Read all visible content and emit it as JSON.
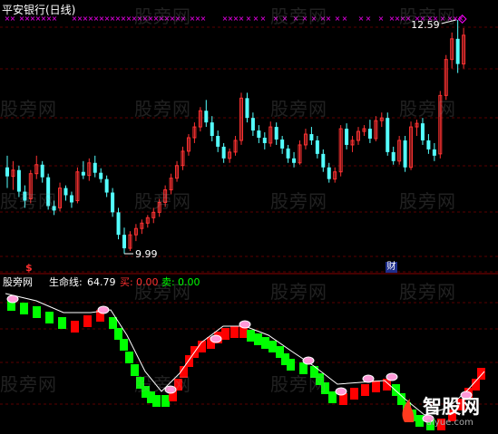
{
  "upper": {
    "title": "平安银行(日线)",
    "high_label": "12.59",
    "low_label": "9.99",
    "event_markers": [
      {
        "text": "$",
        "color": "#ff3030"
      },
      {
        "text": "财",
        "color": "#ffffff"
      }
    ]
  },
  "lower": {
    "name": "股旁网",
    "lifeline_label": "生命线:",
    "lifeline_value": "64.79",
    "buy_label": "买:",
    "buy_value": "0.00",
    "sell_label": "卖:",
    "sell_value": "0.00"
  },
  "watermark": "股旁网",
  "logo": {
    "text": "智股网",
    "url": "aiyue.com"
  },
  "colors": {
    "up": "#ff3232",
    "down": "#54ffff",
    "red": "#ff0000",
    "green": "#00ff00",
    "grid": "#5a0000",
    "magenta": "#ff00ff"
  },
  "chart_data": [
    {
      "type": "candlestick",
      "title": "平安银行(日线)",
      "annotations": [
        "12.59",
        "9.99"
      ],
      "ohlc": [
        [
          10.95,
          11.08,
          10.72,
          10.85
        ],
        [
          10.85,
          11.02,
          10.7,
          10.92
        ],
        [
          10.92,
          10.97,
          10.62,
          10.68
        ],
        [
          10.68,
          10.75,
          10.5,
          10.58
        ],
        [
          10.6,
          10.92,
          10.55,
          10.88
        ],
        [
          10.88,
          11.08,
          10.82,
          10.98
        ],
        [
          10.98,
          11.02,
          10.78,
          10.84
        ],
        [
          10.84,
          10.88,
          10.48,
          10.52
        ],
        [
          10.52,
          10.58,
          10.42,
          10.47
        ],
        [
          10.5,
          10.78,
          10.46,
          10.72
        ],
        [
          10.72,
          10.75,
          10.58,
          10.64
        ],
        [
          10.64,
          10.68,
          10.5,
          10.56
        ],
        [
          10.58,
          10.95,
          10.55,
          10.9
        ],
        [
          10.9,
          11.02,
          10.82,
          10.86
        ],
        [
          10.86,
          11.05,
          10.8,
          11.0
        ],
        [
          11.0,
          11.08,
          10.84,
          10.89
        ],
        [
          10.89,
          10.94,
          10.78,
          10.82
        ],
        [
          10.82,
          10.86,
          10.62,
          10.67
        ],
        [
          10.67,
          10.72,
          10.4,
          10.45
        ],
        [
          10.45,
          10.5,
          10.15,
          10.2
        ],
        [
          10.2,
          10.28,
          9.99,
          10.05
        ],
        [
          10.05,
          10.24,
          10.02,
          10.2
        ],
        [
          10.2,
          10.32,
          10.13,
          10.27
        ],
        [
          10.27,
          10.37,
          10.21,
          10.33
        ],
        [
          10.33,
          10.42,
          10.28,
          10.39
        ],
        [
          10.39,
          10.5,
          10.33,
          10.45
        ],
        [
          10.45,
          10.6,
          10.4,
          10.56
        ],
        [
          10.56,
          10.75,
          10.51,
          10.7
        ],
        [
          10.7,
          10.88,
          10.65,
          10.83
        ],
        [
          10.83,
          11.02,
          10.79,
          10.97
        ],
        [
          10.97,
          11.18,
          10.92,
          11.13
        ],
        [
          11.13,
          11.32,
          11.08,
          11.28
        ],
        [
          11.28,
          11.45,
          11.22,
          11.4
        ],
        [
          11.4,
          11.62,
          11.35,
          11.58
        ],
        [
          11.58,
          11.7,
          11.4,
          11.45
        ],
        [
          11.45,
          11.52,
          11.24,
          11.3
        ],
        [
          11.3,
          11.36,
          11.12,
          11.18
        ],
        [
          11.18,
          11.22,
          11.0,
          11.05
        ],
        [
          11.05,
          11.16,
          11.0,
          11.12
        ],
        [
          11.12,
          11.3,
          11.08,
          11.25
        ],
        [
          11.25,
          11.78,
          11.2,
          11.72
        ],
        [
          11.72,
          11.78,
          11.45,
          11.5
        ],
        [
          11.5,
          11.56,
          11.3,
          11.36
        ],
        [
          11.36,
          11.42,
          11.22,
          11.28
        ],
        [
          11.28,
          11.34,
          11.15,
          11.22
        ],
        [
          11.22,
          11.46,
          11.18,
          11.4
        ],
        [
          11.4,
          11.45,
          11.2,
          11.26
        ],
        [
          11.26,
          11.3,
          11.1,
          11.16
        ],
        [
          11.16,
          11.2,
          11.0,
          11.05
        ],
        [
          11.05,
          11.12,
          10.95,
          11.0
        ],
        [
          11.0,
          11.25,
          10.98,
          11.2
        ],
        [
          11.2,
          11.38,
          11.15,
          11.32
        ],
        [
          11.32,
          11.4,
          11.2,
          11.25
        ],
        [
          11.25,
          11.3,
          11.05,
          11.1
        ],
        [
          11.1,
          11.15,
          10.9,
          10.95
        ],
        [
          10.95,
          11.0,
          10.78,
          10.82
        ],
        [
          10.82,
          10.95,
          10.78,
          10.9
        ],
        [
          10.9,
          11.42,
          10.85,
          11.38
        ],
        [
          11.38,
          11.44,
          11.15,
          11.2
        ],
        [
          11.2,
          11.3,
          11.12,
          11.25
        ],
        [
          11.25,
          11.4,
          11.2,
          11.35
        ],
        [
          11.35,
          11.42,
          11.3,
          11.38
        ],
        [
          11.38,
          11.48,
          11.22,
          11.27
        ],
        [
          11.27,
          11.52,
          11.24,
          11.47
        ],
        [
          11.47,
          11.56,
          11.4,
          11.5
        ],
        [
          11.5,
          11.56,
          11.08,
          11.12
        ],
        [
          11.12,
          11.18,
          10.98,
          11.02
        ],
        [
          11.02,
          11.3,
          10.98,
          11.25
        ],
        [
          11.25,
          11.3,
          10.9,
          10.95
        ],
        [
          10.95,
          11.46,
          10.92,
          11.4
        ],
        [
          11.4,
          11.48,
          11.3,
          11.44
        ],
        [
          11.44,
          11.5,
          11.2,
          11.25
        ],
        [
          11.25,
          11.32,
          11.1,
          11.15
        ],
        [
          11.15,
          11.22,
          11.02,
          11.08
        ],
        [
          11.1,
          11.8,
          11.05,
          11.75
        ],
        [
          11.75,
          12.2,
          11.7,
          12.15
        ],
        [
          12.15,
          12.45,
          12.05,
          12.38
        ],
        [
          12.38,
          12.59,
          12.0,
          12.1
        ],
        [
          12.1,
          12.5,
          12.05,
          12.42
        ]
      ]
    },
    {
      "type": "step-band",
      "series": [
        {
          "name": "生命线",
          "values": [
            64.79
          ]
        },
        {
          "name": "买",
          "values": [
            0.0
          ]
        },
        {
          "name": "卖",
          "values": [
            0.0
          ]
        }
      ]
    }
  ]
}
